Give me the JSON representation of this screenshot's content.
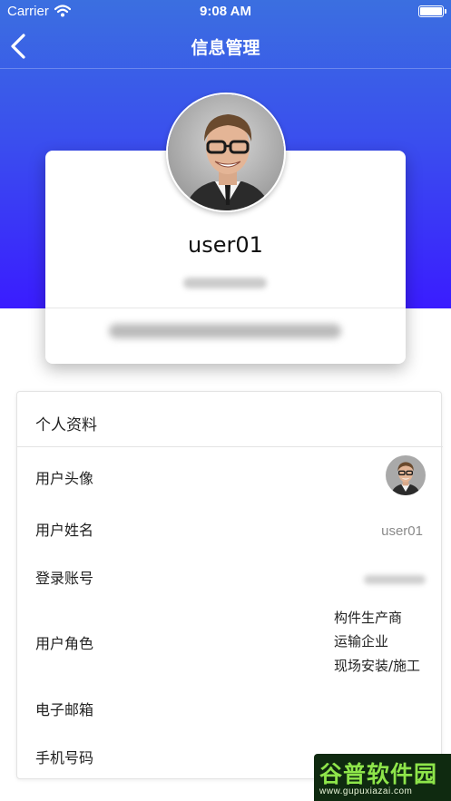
{
  "status_bar": {
    "carrier": "Carrier",
    "time": "9:08 AM",
    "icons": [
      "wifi-icon",
      "battery-icon"
    ]
  },
  "nav": {
    "title": "信息管理",
    "back_icon": "chevron-left-icon"
  },
  "colors": {
    "hero_top": "#3b6fe0",
    "hero_bottom": "#3a1cff",
    "label_gray": "#8a8a8a"
  },
  "profile": {
    "username": "user01",
    "avatar": "user-avatar-photo"
  },
  "details": {
    "section_title": "个人资料",
    "rows": {
      "avatar_label": "用户头像",
      "name_label": "用户姓名",
      "name_value": "user01",
      "login_label": "登录账号",
      "role_label": "用户角色",
      "roles": [
        "构件生产商",
        "运输企业",
        "现场安装/施工"
      ],
      "email_label": "电子邮箱",
      "phone_label": "手机号码"
    }
  },
  "watermark": {
    "text": "谷普软件园",
    "url": "www.gupuxiazai.com"
  }
}
